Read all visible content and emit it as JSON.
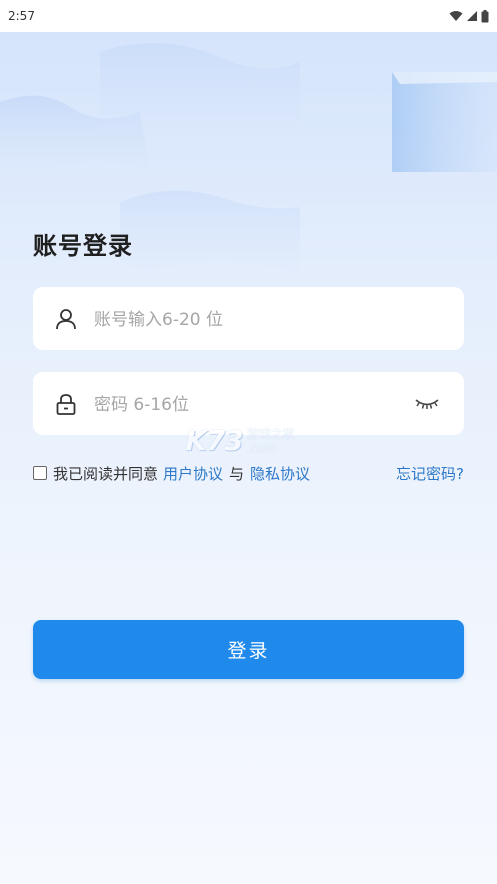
{
  "status_bar": {
    "time": "2:57",
    "icons": [
      "wifi-icon",
      "signal-icon",
      "battery-icon"
    ]
  },
  "page": {
    "title": "账号登录"
  },
  "account_field": {
    "icon": "user-icon",
    "placeholder": "账号输入6-20 位"
  },
  "password_field": {
    "icon": "lock-icon",
    "placeholder": "密码 6-16位",
    "toggle_icon": "eye-closed-icon"
  },
  "agreement": {
    "prefix": "我已阅读并同意",
    "user_agreement": "用户协议",
    "conjunction": "与",
    "privacy_agreement": "隐私协议",
    "checked": false
  },
  "forgot_password": "忘记密码?",
  "login_button": "登录",
  "watermark": {
    "logo": "K73",
    "line1": "游戏之家",
    "line2": ".com"
  },
  "colors": {
    "accent": "#1f8aeb",
    "link": "#2d78c8",
    "background_top": "#d3e3fb"
  }
}
